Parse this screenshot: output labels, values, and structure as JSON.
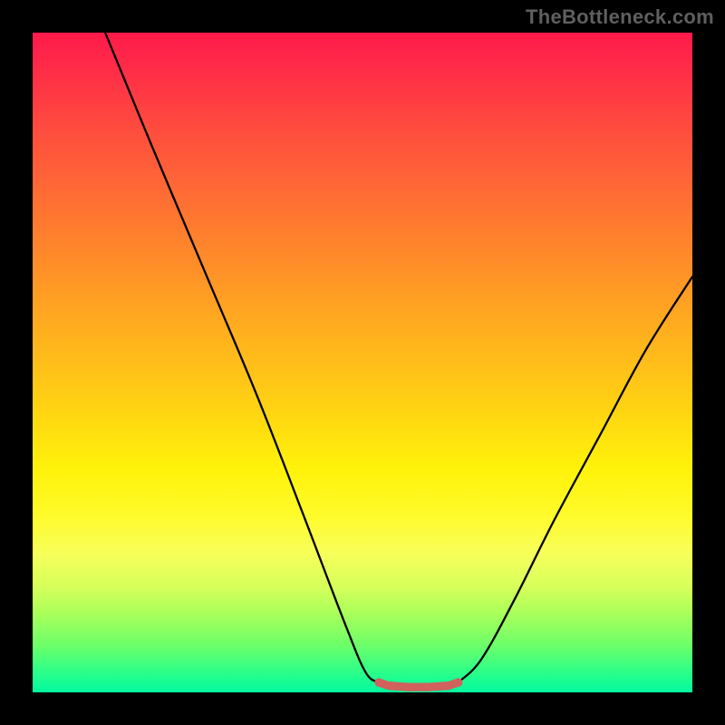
{
  "watermark": "TheBottleneck.com",
  "chart_data": {
    "type": "line",
    "title": "",
    "xlabel": "",
    "ylabel": "",
    "xlim": [
      0,
      100
    ],
    "ylim": [
      0,
      100
    ],
    "grid": false,
    "legend": false,
    "series": [
      {
        "name": "left-descending-curve",
        "x": [
          11,
          18,
          26,
          34,
          41,
          47.5,
          50.5,
          52.5
        ],
        "values": [
          100,
          83,
          64,
          45,
          27,
          10,
          3,
          1.5
        ]
      },
      {
        "name": "valley-floor-dotted",
        "x": [
          52.5,
          54,
          55.5,
          57,
          58.5,
          60,
          61.5,
          63,
          64.5
        ],
        "values": [
          1.5,
          1.0,
          0.9,
          0.8,
          0.8,
          0.8,
          0.9,
          1.0,
          1.5
        ]
      },
      {
        "name": "right-ascending-curve",
        "x": [
          64.5,
          68,
          73,
          79,
          86,
          93,
          100
        ],
        "values": [
          1.5,
          5,
          14,
          26,
          39,
          52,
          63
        ]
      }
    ],
    "annotations": []
  },
  "colors": {
    "background": "#000000",
    "curve": "#000000",
    "valley_dots": "#d1615d",
    "gradient_top": "#ff1a4b",
    "gradient_bottom": "#00f9a0",
    "watermark": "#5f5f5f"
  }
}
